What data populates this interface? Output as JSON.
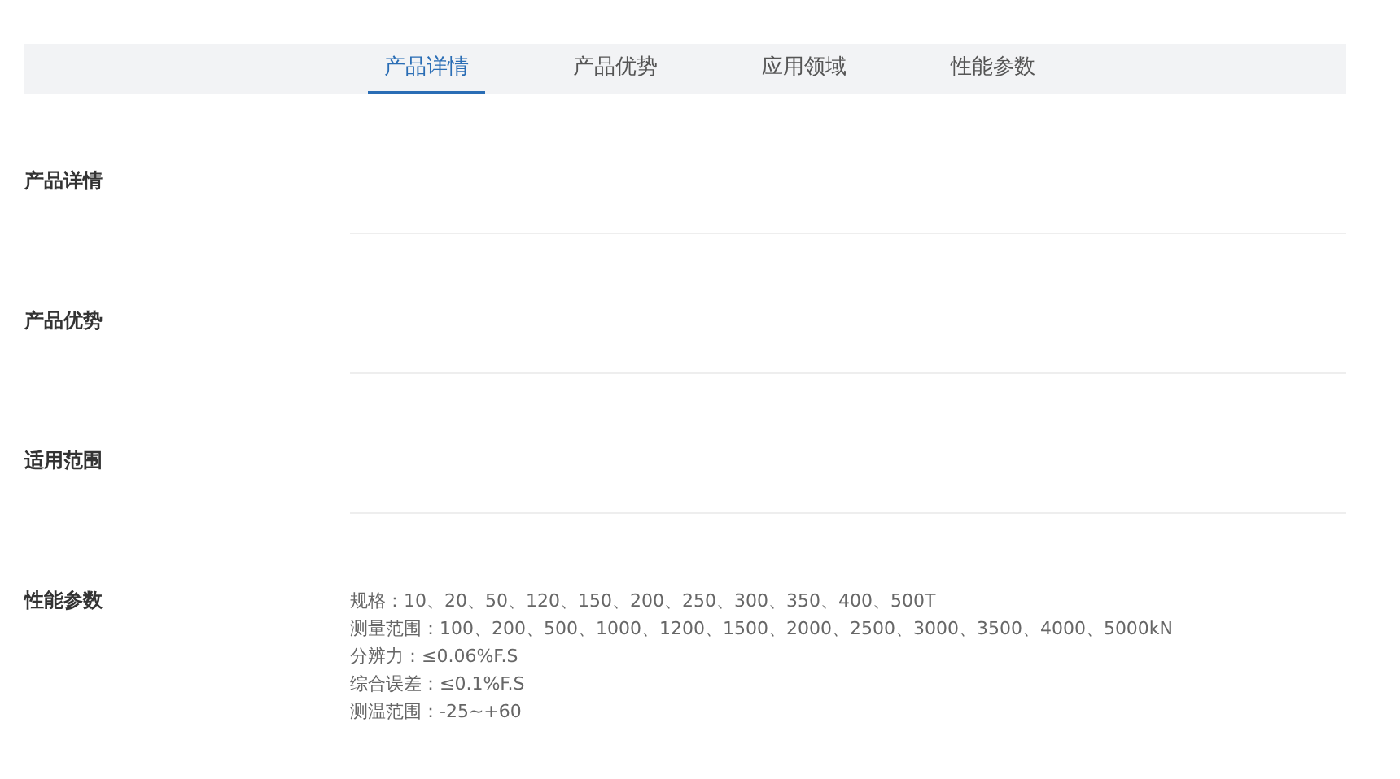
{
  "tabs": [
    {
      "label": "产品详情",
      "selected": true
    },
    {
      "label": "产品优势",
      "selected": false
    },
    {
      "label": "应用领域",
      "selected": false
    },
    {
      "label": "性能参数",
      "selected": false
    }
  ],
  "sections": [
    {
      "title": "产品详情"
    },
    {
      "title": "产品优势"
    },
    {
      "title": "适用范围"
    },
    {
      "title": "性能参数",
      "lines": [
        "规格：10、20、50、120、150、200、250、300、350、400、500T",
        "测量范围：100、200、500、1000、1200、1500、2000、2500、3000、3500、4000、5000kN",
        "分辨力：≤0.06%F.S",
        "综合误差：≤0.1%F.S",
        "测温范围：-25~+60"
      ]
    }
  ]
}
